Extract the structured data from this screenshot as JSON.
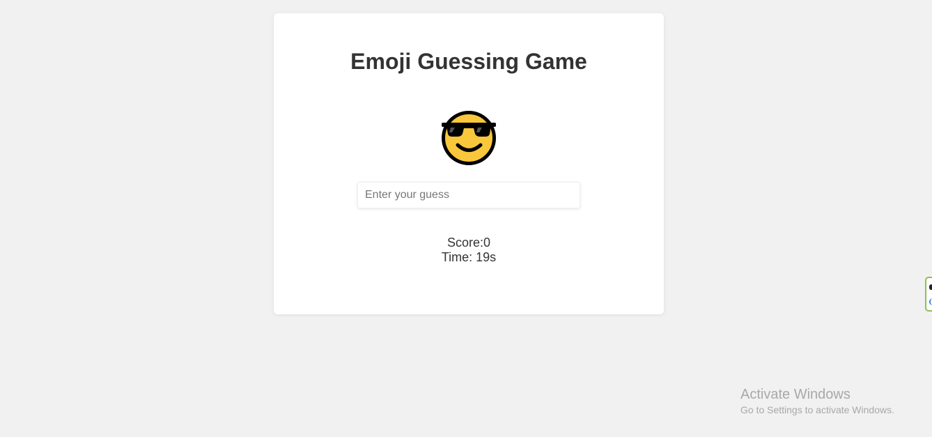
{
  "game": {
    "title": "Emoji Guessing Game",
    "emoji": {
      "icon": "smiling-face-with-sunglasses",
      "face_color": "#f9c73c",
      "outline_color": "#000000"
    },
    "guess_input": {
      "value": "",
      "placeholder": "Enter your guess"
    },
    "score_text": "Score:0",
    "time_text": "Time: 19s"
  },
  "side_widget": {
    "border_color": "#8bc34a"
  },
  "watermark": {
    "title": "Activate Windows",
    "subtitle": "Go to Settings to activate Windows."
  }
}
